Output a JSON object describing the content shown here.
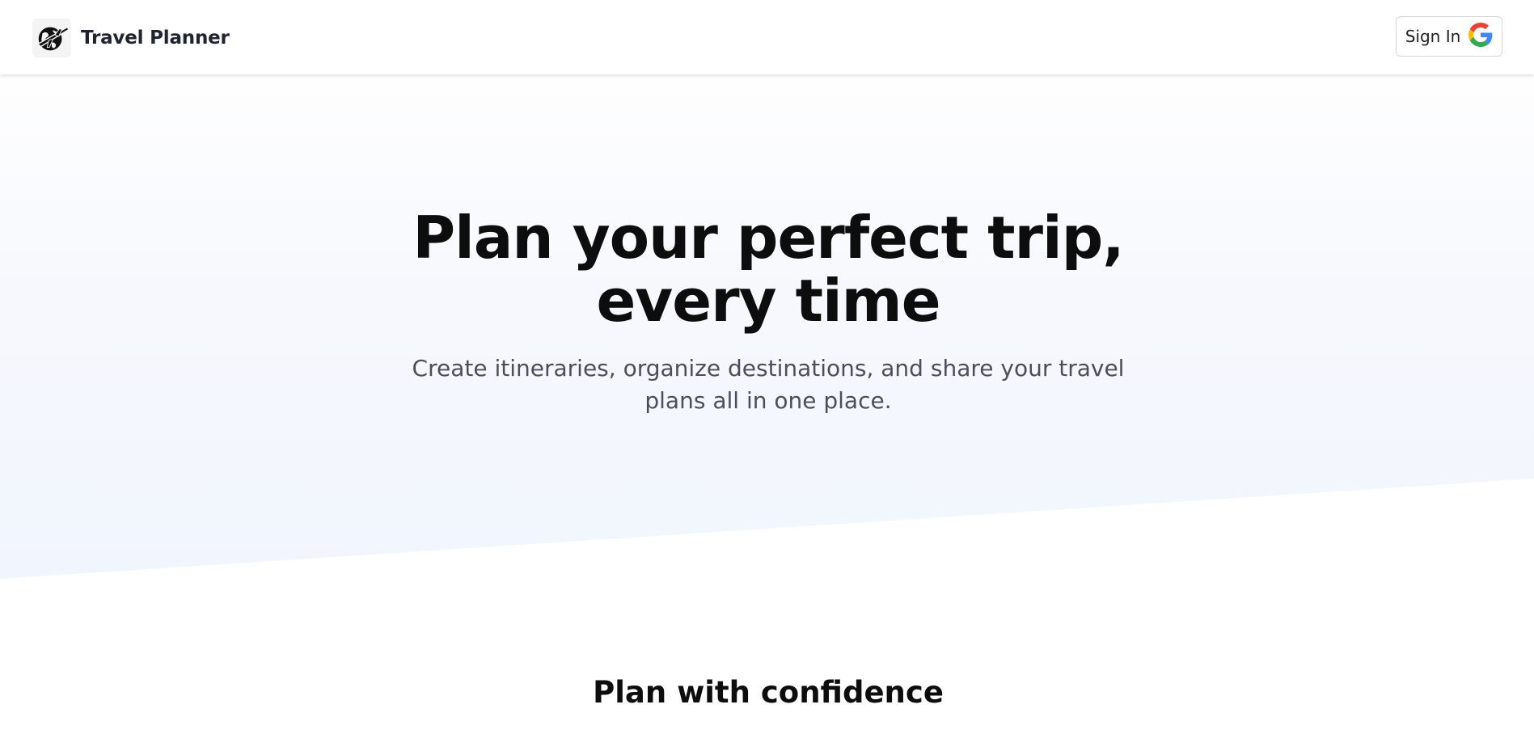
{
  "header": {
    "brand_name": "Travel Planner",
    "logo_icon": "globe-airplane-icon",
    "sign_in_label": "Sign In",
    "sign_in_icon": "google-icon"
  },
  "hero": {
    "title_line1": "Plan your perfect trip,",
    "title_line2": "every time",
    "subtitle": "Create itineraries, organize destinations, and share your travel plans all in one place."
  },
  "features": {
    "title": "Plan with confidence"
  },
  "colors": {
    "hero_gradient_top": "#fefefe",
    "hero_gradient_bottom": "#f1f5fd",
    "google_blue": "#4285F4",
    "google_red": "#EA4335",
    "google_yellow": "#FBBC05",
    "google_green": "#34A853"
  }
}
